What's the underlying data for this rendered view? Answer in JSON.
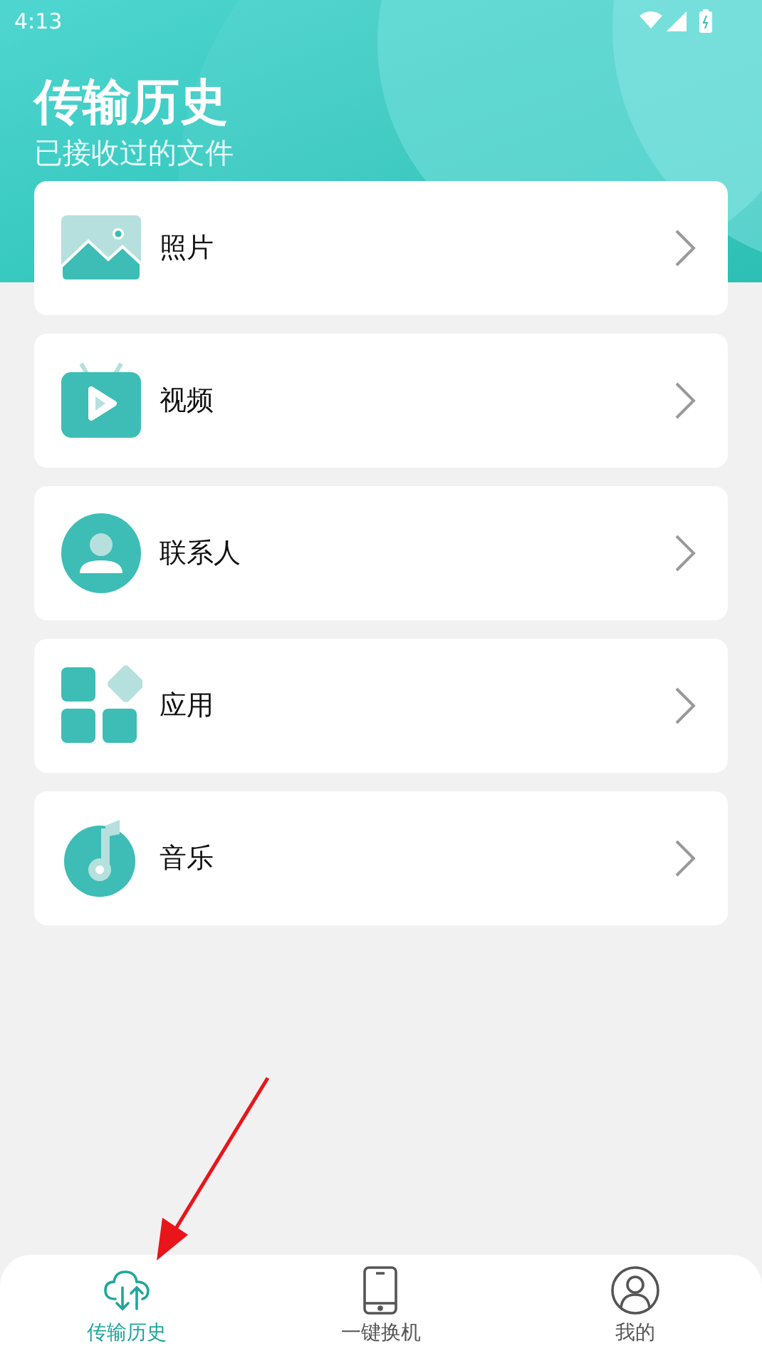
{
  "status_bar": {
    "time": "4:13"
  },
  "header": {
    "title": "传输历史",
    "subtitle": "已接收过的文件"
  },
  "categories": [
    {
      "kind": "photos",
      "label": "照片"
    },
    {
      "kind": "videos",
      "label": "视频"
    },
    {
      "kind": "contacts",
      "label": "联系人"
    },
    {
      "kind": "apps",
      "label": "应用"
    },
    {
      "kind": "music",
      "label": "音乐"
    }
  ],
  "bottom_nav": [
    {
      "kind": "history",
      "label": "传输历史",
      "selected": true
    },
    {
      "kind": "phone",
      "label": "一键换机",
      "selected": false
    },
    {
      "kind": "profile",
      "label": "我的",
      "selected": false
    }
  ]
}
